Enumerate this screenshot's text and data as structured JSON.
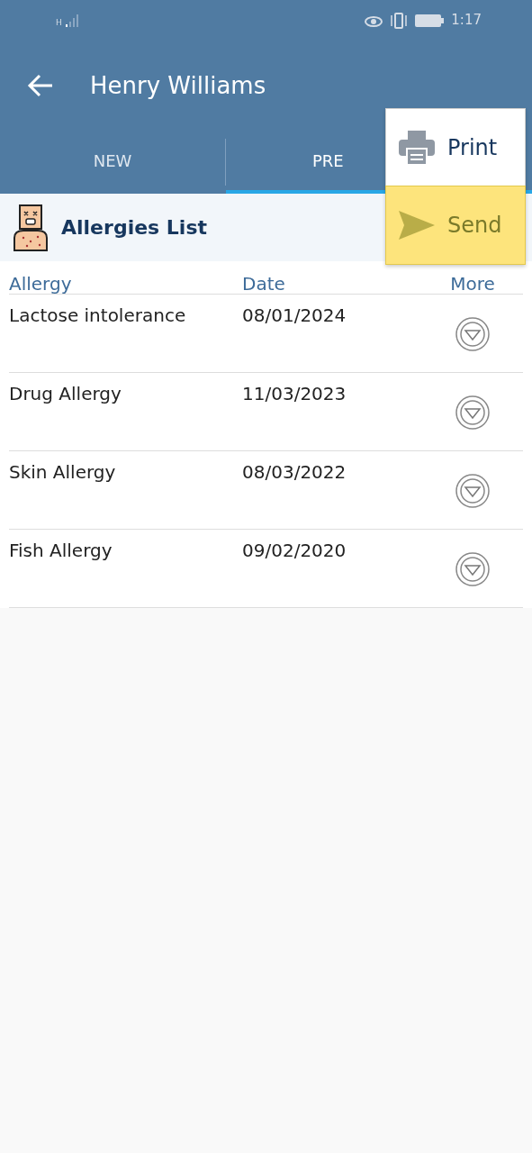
{
  "status_bar": {
    "time": "1:17",
    "network": "H"
  },
  "app_bar": {
    "title": "Henry Williams"
  },
  "tabs": [
    {
      "label": "NEW",
      "selected": false
    },
    {
      "label": "PRE",
      "selected": true
    }
  ],
  "section": {
    "title": "Allergies List"
  },
  "table": {
    "columns": [
      "Allergy",
      "Date",
      "More"
    ],
    "rows": [
      {
        "allergy": "Lactose intolerance",
        "date": "08/01/2024"
      },
      {
        "allergy": "Drug Allergy",
        "date": "11/03/2023"
      },
      {
        "allergy": "Skin Allergy",
        "date": "08/03/2022"
      },
      {
        "allergy": "Fish Allergy",
        "date": "09/02/2020"
      }
    ]
  },
  "menu": {
    "items": [
      {
        "kind": "print",
        "label": "Print",
        "selected": false
      },
      {
        "kind": "send",
        "label": "Send",
        "selected": true
      }
    ]
  }
}
